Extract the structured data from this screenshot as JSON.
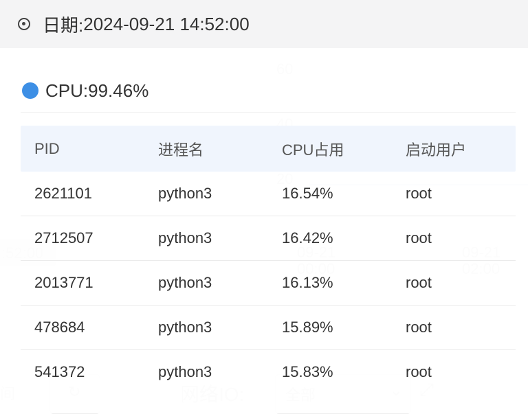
{
  "background": {
    "y_tick_60": "60",
    "y_tick_40": "40",
    "y_tick_20": "20",
    "x_tick_1": "09-21\n00:00",
    "x_tick_2": "09-21\n02:00",
    "time_pill": ":52:00",
    "network_io_label": "网络IO:",
    "network_io_select": "全部",
    "time_label": "间"
  },
  "tooltip": {
    "date_label": "日期:",
    "date_value": "2024-09-21 14:52:00",
    "cpu_label": "CPU:",
    "cpu_value": "99.46%",
    "cpu_color": "#3d8fe5",
    "columns": [
      "PID",
      "进程名",
      "CPU占用",
      "启动用户"
    ],
    "rows": [
      [
        "2621101",
        "python3",
        "16.54%",
        "root"
      ],
      [
        "2712507",
        "python3",
        "16.42%",
        "root"
      ],
      [
        "2013771",
        "python3",
        "16.13%",
        "root"
      ],
      [
        "478684",
        "python3",
        "15.89%",
        "root"
      ],
      [
        "541372",
        "python3",
        "15.83%",
        "root"
      ]
    ]
  }
}
